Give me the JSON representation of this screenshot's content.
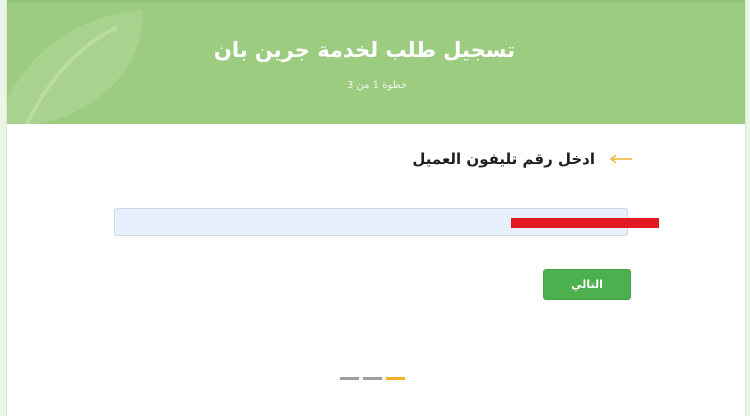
{
  "header": {
    "title": "تسجيل طلب لخدمة جرين بان",
    "step_text": "خطوة 1 من 3"
  },
  "form": {
    "prompt_label": "ادخل رقم تليفون العميل",
    "phone_value": "",
    "next_label": "التالي"
  },
  "progress": {
    "total_steps": 3,
    "current_step": 1
  },
  "icons": {
    "prompt_arrow": "arrow-left-icon",
    "header_decoration": "leaf-icon"
  },
  "colors": {
    "header_bg": "#9ccc7f",
    "button_bg": "#4cb04f",
    "arrow": "#f0b12c",
    "active_step": "#f0b12c",
    "inactive_step": "#9e9e9e",
    "redaction": "#e31a22"
  }
}
